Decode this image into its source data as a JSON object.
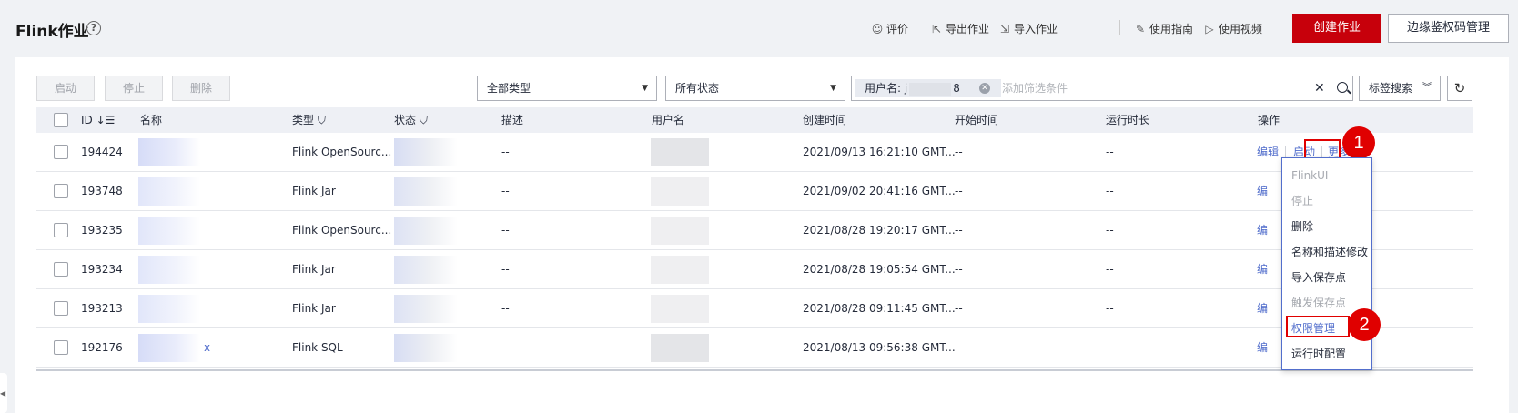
{
  "header": {
    "title": "Flink作业",
    "links": {
      "rate": "评价",
      "export": "导出作业",
      "import": "导入作业",
      "guide": "使用指南",
      "video": "使用视频"
    },
    "create_label": "创建作业",
    "edge_auth_label": "边缘鉴权码管理"
  },
  "toolbar": {
    "start_label": "启动",
    "stop_label": "停止",
    "delete_label": "删除",
    "type_select_value": "全部类型",
    "status_select_value": "所有状态",
    "filter_chip_prefix": "用户名: j",
    "filter_chip_suffix": "8",
    "search_placeholder": "添加筛选条件",
    "tag_search_label": "标签搜索"
  },
  "table": {
    "columns": {
      "id": "ID",
      "name": "名称",
      "type": "类型",
      "status": "状态",
      "desc": "描述",
      "user": "用户名",
      "created": "创建时间",
      "start": "开始时间",
      "runtime": "运行时长",
      "ops": "操作"
    },
    "rows": [
      {
        "id": "194424",
        "name_tail": "",
        "type": "Flink OpenSourc...",
        "desc": "--",
        "created": "2021/09/13 16:21:10 GMT...",
        "start": "--",
        "runtime": "--"
      },
      {
        "id": "193748",
        "name_tail": "",
        "type": "Flink Jar",
        "desc": "--",
        "created": "2021/09/02 20:41:16 GMT...",
        "start": "--",
        "runtime": "--"
      },
      {
        "id": "193235",
        "name_tail": "",
        "type": "Flink OpenSourc...",
        "desc": "--",
        "created": "2021/08/28 19:20:17 GMT...",
        "start": "--",
        "runtime": "--"
      },
      {
        "id": "193234",
        "name_tail": "",
        "type": "Flink Jar",
        "desc": "--",
        "created": "2021/08/28 19:05:54 GMT...",
        "start": "--",
        "runtime": "--"
      },
      {
        "id": "193213",
        "name_tail": "",
        "type": "Flink Jar",
        "desc": "--",
        "created": "2021/08/28 09:11:45 GMT...",
        "start": "--",
        "runtime": "--"
      },
      {
        "id": "192176",
        "name_tail": "x",
        "type": "Flink SQL",
        "desc": "--",
        "created": "2021/08/13 09:56:38 GMT...",
        "start": "--",
        "runtime": "--"
      }
    ],
    "actions": {
      "edit": "编辑",
      "start": "启动",
      "more": "更多",
      "edit_short": "编"
    }
  },
  "menu": {
    "items": [
      "FlinkUI",
      "停止",
      "删除",
      "名称和描述修改",
      "导入保存点",
      "触发保存点",
      "权限管理",
      "运行时配置"
    ]
  },
  "callouts": {
    "one": "1",
    "two": "2"
  },
  "colors": {
    "primary": "#c7000b",
    "link": "#526ecc",
    "callout": "#e00000"
  }
}
